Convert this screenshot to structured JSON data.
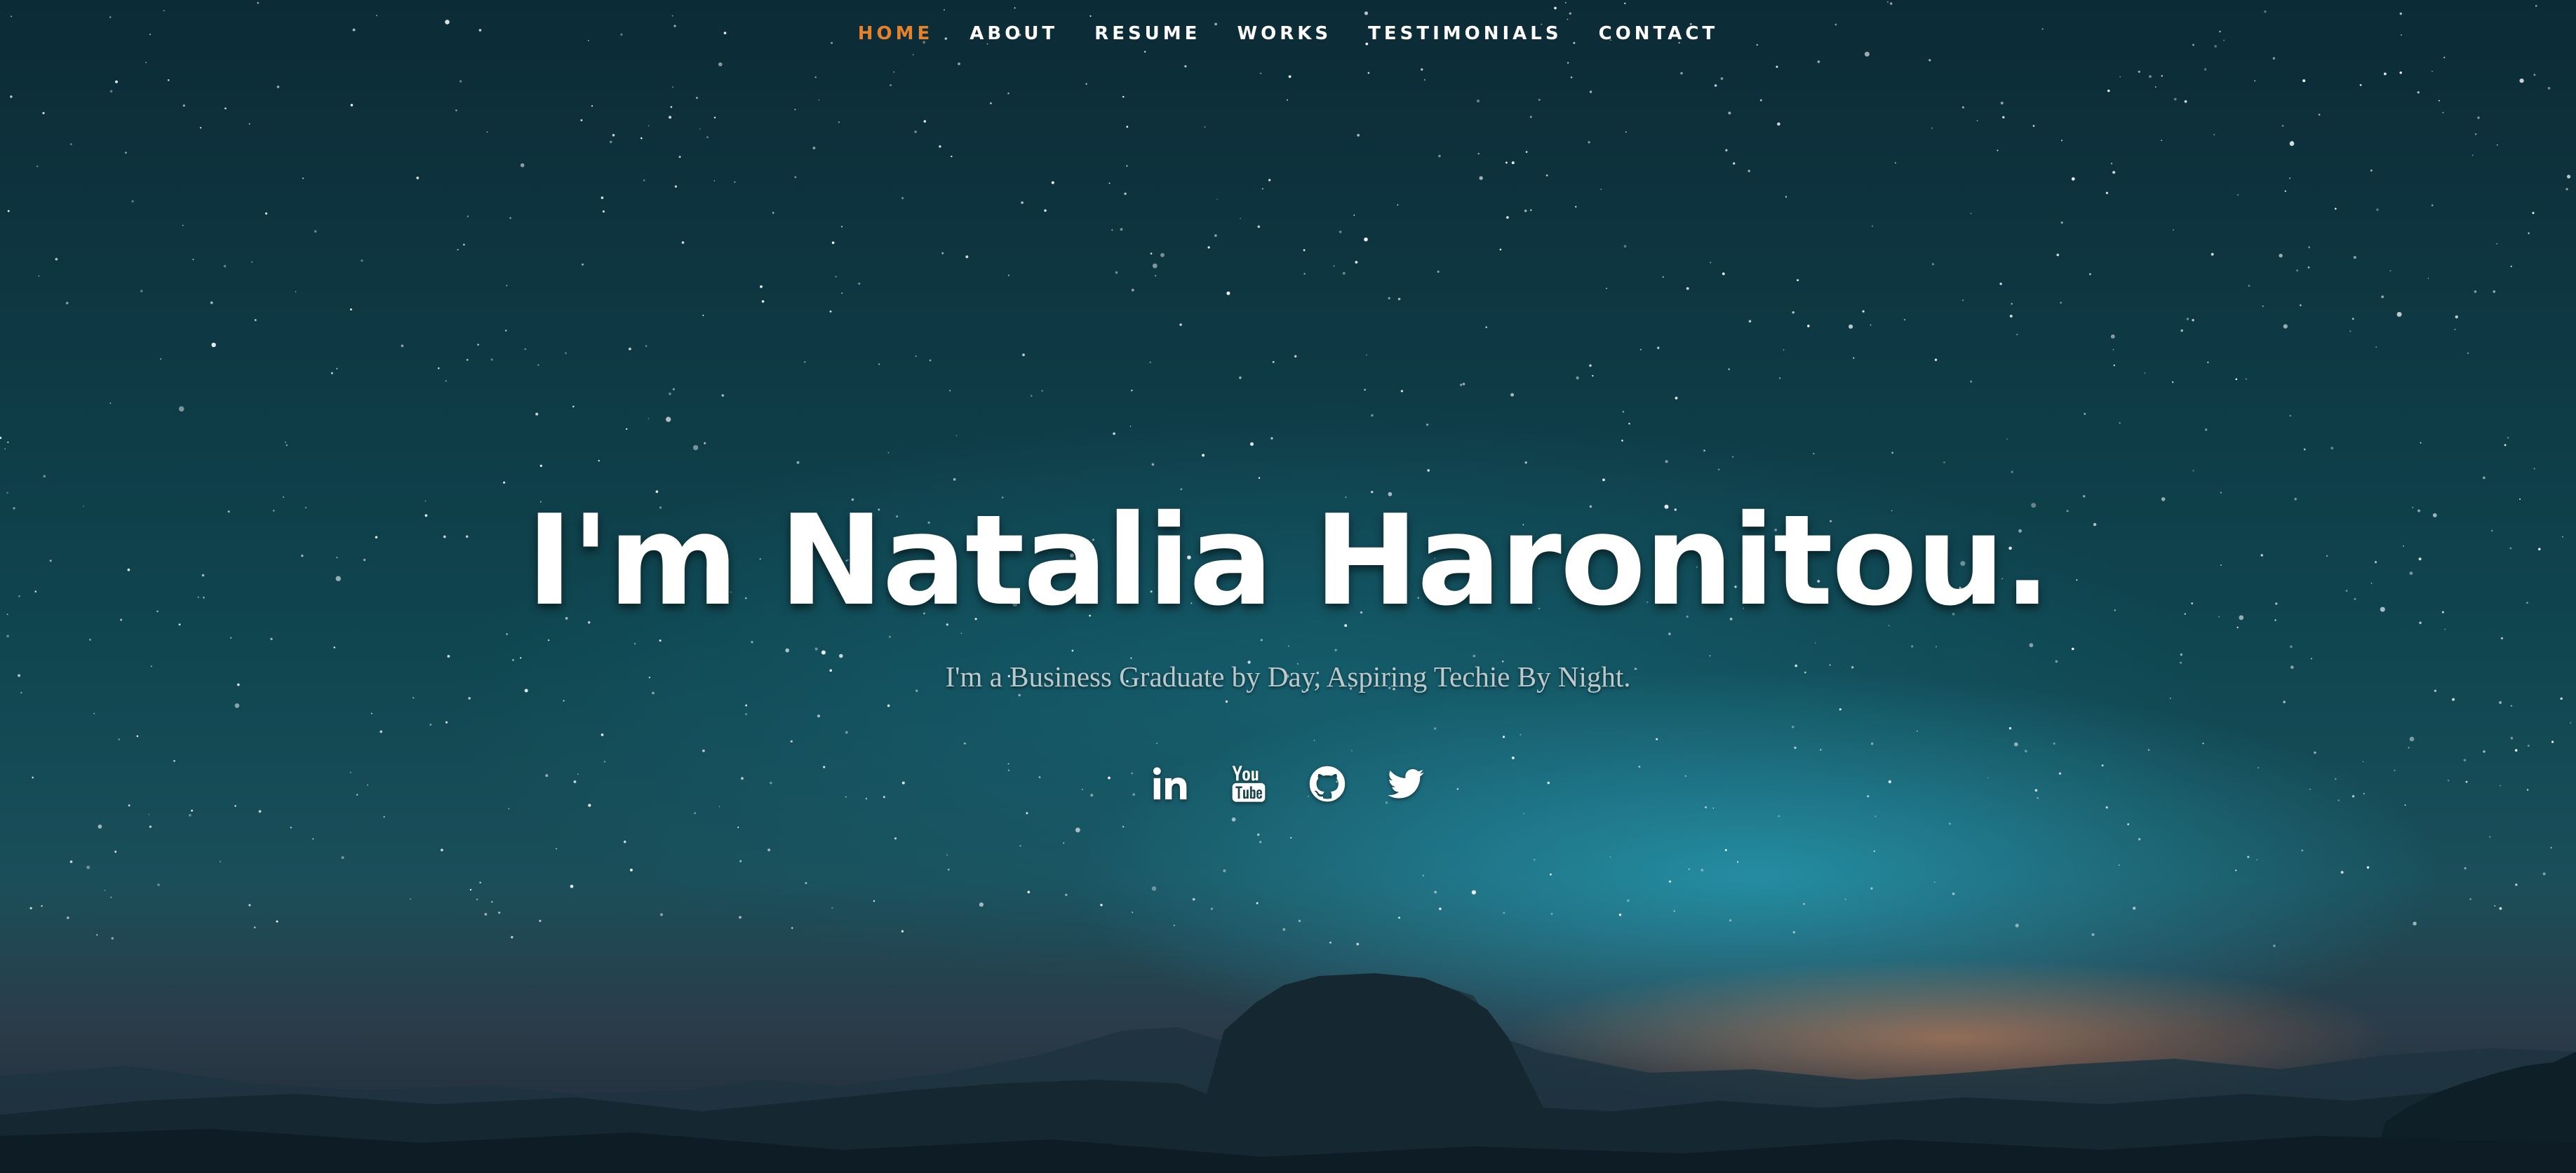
{
  "colors": {
    "nav_active": "#e7812a",
    "text": "#ffffff",
    "subtitle": "#b9c9cc"
  },
  "nav": {
    "items": [
      {
        "label": "HOME",
        "active": true
      },
      {
        "label": "ABOUT",
        "active": false
      },
      {
        "label": "RESUME",
        "active": false
      },
      {
        "label": "WORKS",
        "active": false
      },
      {
        "label": "TESTIMONIALS",
        "active": false
      },
      {
        "label": "CONTACT",
        "active": false
      }
    ]
  },
  "hero": {
    "headline": "I'm Natalia Haronitou.",
    "subtitle": "I'm a Business Graduate by Day, Aspiring Techie By Night."
  },
  "social": {
    "items": [
      {
        "icon": "linkedin-icon"
      },
      {
        "icon": "youtube-icon"
      },
      {
        "icon": "github-icon"
      },
      {
        "icon": "twitter-icon"
      }
    ]
  }
}
